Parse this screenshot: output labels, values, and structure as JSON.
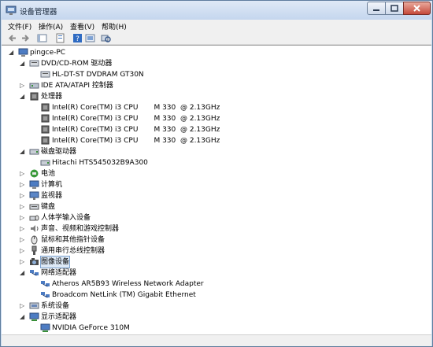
{
  "window": {
    "title": "设备管理器"
  },
  "menu": [
    "文件(F)",
    "操作(A)",
    "查看(V)",
    "帮助(H)"
  ],
  "toolbar": {
    "back_icon": "back-arrow-icon",
    "forward_icon": "forward-arrow-icon",
    "view_icon": "view-icon",
    "properties_icon": "properties-icon",
    "help_icon": "help-icon",
    "action_icon": "action-icon",
    "scan_icon": "scan-hardware-icon"
  },
  "tree": {
    "root": "pingce-PC",
    "nodes": [
      {
        "label": "DVD/CD-ROM 驱动器",
        "expanded": true,
        "icon": "dvd-drive-icon",
        "children": [
          "HL-DT-ST DVDRAM GT30N"
        ]
      },
      {
        "label": "IDE ATA/ATAPI 控制器",
        "expanded": false,
        "icon": "ide-controller-icon",
        "children": []
      },
      {
        "label": "处理器",
        "expanded": true,
        "icon": "processor-icon",
        "children": [
          "Intel(R) Core(TM) i3 CPU       M 330  @ 2.13GHz",
          "Intel(R) Core(TM) i3 CPU       M 330  @ 2.13GHz",
          "Intel(R) Core(TM) i3 CPU       M 330  @ 2.13GHz",
          "Intel(R) Core(TM) i3 CPU       M 330  @ 2.13GHz"
        ]
      },
      {
        "label": "磁盘驱动器",
        "expanded": true,
        "icon": "disk-drive-icon",
        "children": [
          "Hitachi HTS545032B9A300"
        ]
      },
      {
        "label": "电池",
        "expanded": false,
        "icon": "battery-icon",
        "children": []
      },
      {
        "label": "计算机",
        "expanded": false,
        "icon": "computer-icon",
        "children": []
      },
      {
        "label": "监视器",
        "expanded": false,
        "icon": "monitor-icon",
        "children": []
      },
      {
        "label": "键盘",
        "expanded": false,
        "icon": "keyboard-icon",
        "children": []
      },
      {
        "label": "人体学输入设备",
        "expanded": false,
        "icon": "hid-icon",
        "children": []
      },
      {
        "label": "声音、视频和游戏控制器",
        "expanded": false,
        "icon": "sound-icon",
        "children": []
      },
      {
        "label": "鼠标和其他指针设备",
        "expanded": false,
        "icon": "mouse-icon",
        "children": []
      },
      {
        "label": "通用串行总线控制器",
        "expanded": false,
        "icon": "usb-icon",
        "children": []
      },
      {
        "label": "图像设备",
        "expanded": false,
        "icon": "camera-icon",
        "selected": true,
        "children": []
      },
      {
        "label": "网络适配器",
        "expanded": true,
        "icon": "network-adapter-icon",
        "children": [
          "Atheros AR5B93 Wireless Network Adapter",
          "Broadcom NetLink (TM) Gigabit Ethernet"
        ]
      },
      {
        "label": "系统设备",
        "expanded": false,
        "icon": "system-device-icon",
        "children": []
      },
      {
        "label": "显示适配器",
        "expanded": true,
        "icon": "display-adapter-icon",
        "children": [
          "NVIDIA GeForce 310M"
        ]
      }
    ]
  },
  "colors": {
    "selection": "#dde9f6",
    "selection_border": "#7da2ce",
    "window_frame": "#c9daf0"
  }
}
